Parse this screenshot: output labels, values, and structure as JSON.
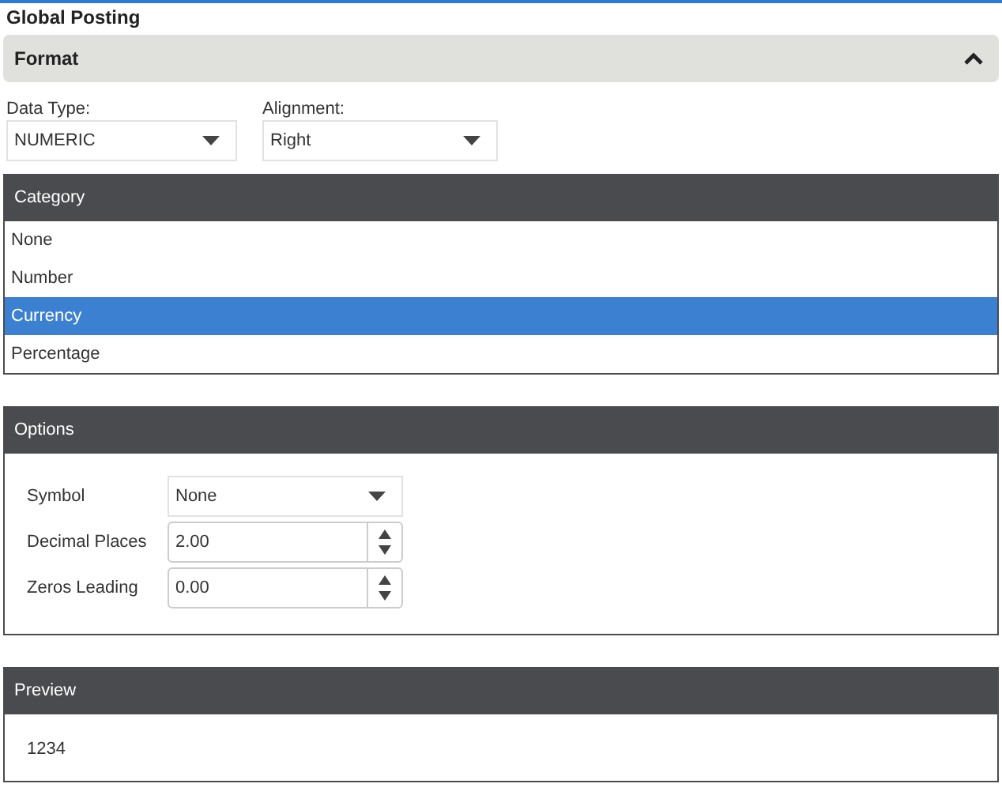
{
  "title": "Global Posting",
  "format": {
    "title": "Format",
    "expanded": true,
    "fields": [
      {
        "label": "Data Type:",
        "value": "NUMERIC"
      },
      {
        "label": "Alignment:",
        "value": "Right"
      }
    ]
  },
  "category": {
    "title": "Category",
    "items": [
      {
        "label": "None",
        "selected": false
      },
      {
        "label": "Number",
        "selected": false
      },
      {
        "label": "Currency",
        "selected": true
      },
      {
        "label": "Percentage",
        "selected": false
      }
    ]
  },
  "options": {
    "title": "Options",
    "rows": [
      {
        "label": "Symbol",
        "kind": "dropdown",
        "value": "None"
      },
      {
        "label": "Decimal Places",
        "kind": "spinner",
        "value": "2.00"
      },
      {
        "label": "Zeros Leading",
        "kind": "spinner",
        "value": "0.00"
      }
    ]
  },
  "preview": {
    "title": "Preview",
    "value": "1234"
  }
}
